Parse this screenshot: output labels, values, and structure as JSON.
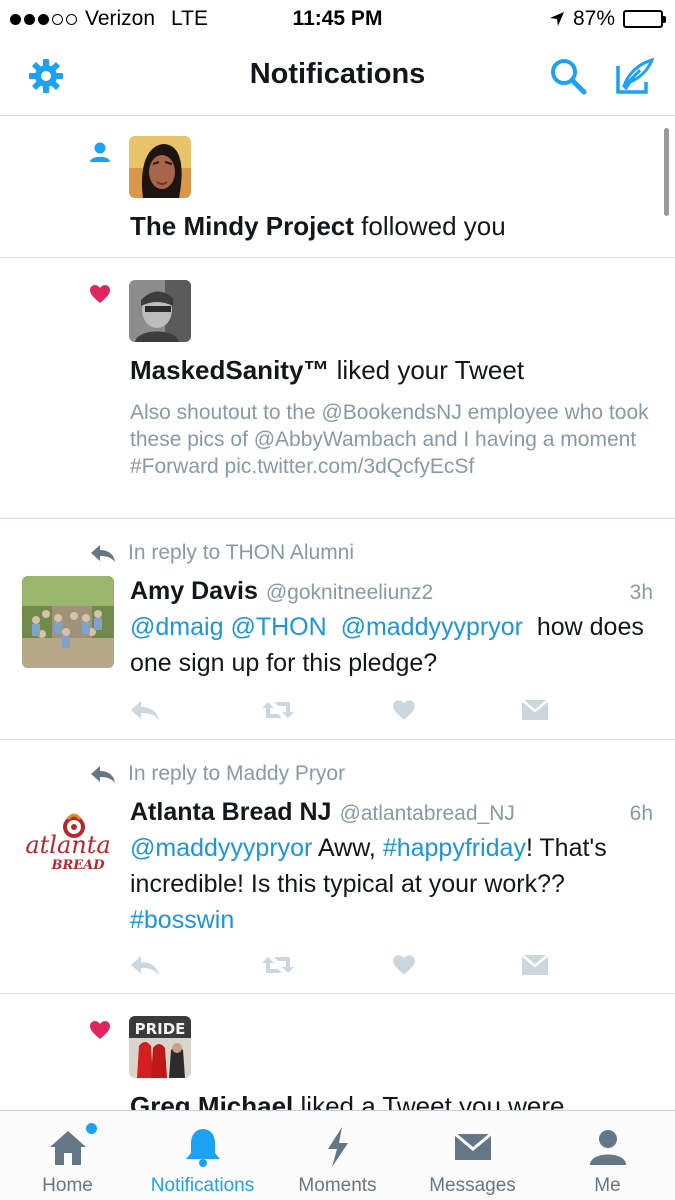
{
  "status_bar": {
    "carrier": "Verizon",
    "network": "LTE",
    "time": "11:45 PM",
    "battery": "87%",
    "battery_level": 0.87,
    "signal_bars": 3
  },
  "nav": {
    "title": "Notifications",
    "settings_icon": "gear-icon",
    "search_icon": "search-icon",
    "compose_icon": "compose-icon"
  },
  "notifications": [
    {
      "type": "follow",
      "icon": "person-icon",
      "actor": "The Mindy Project",
      "action": "followed you"
    },
    {
      "type": "like",
      "icon": "heart-icon",
      "actor": "MaskedSanity™",
      "action": "liked your Tweet",
      "quote": "Also shoutout to the @BookendsNJ employee who took these pics of @AbbyWambach and I having a moment #Forward pic.twitter.com/3dQcfyEcSf"
    },
    {
      "type": "reply",
      "reply_to": "In reply to THON Alumni",
      "name": "Amy Davis",
      "handle": "@goknitneeliunz2",
      "time": "3h",
      "mention1": "@dmaig",
      "mention2": "@THON",
      "mention3": "@maddyyypryor",
      "text_rest": "how does one sign up for this pledge?"
    },
    {
      "type": "reply",
      "reply_to": "In reply to Maddy Pryor",
      "name": "Atlanta Bread NJ",
      "handle": "@atlantabread_NJ",
      "time": "6h",
      "mention1": "@maddyyypryor",
      "text_mid": "Aww,",
      "hashtag1": "#happyfriday",
      "text_rest": "! That's incredible! Is this typical at your work??",
      "hashtag2": "#bosswin",
      "logo_text_1": "atlanta",
      "logo_text_2": "BREAD"
    },
    {
      "type": "like",
      "icon": "heart-icon",
      "actor": "Greg Michael",
      "action": "liked a Tweet you were",
      "avatar_text": "PRIDE"
    }
  ],
  "tabs": [
    {
      "label": "Home",
      "icon": "home-icon",
      "badge": true
    },
    {
      "label": "Notifications",
      "icon": "bell-icon",
      "active": true
    },
    {
      "label": "Moments",
      "icon": "lightning-icon"
    },
    {
      "label": "Messages",
      "icon": "envelope-icon"
    },
    {
      "label": "Me",
      "icon": "person-icon"
    }
  ],
  "colors": {
    "accent": "#1da1f2",
    "link": "#1b95e0",
    "like": "#e0245e",
    "secondary_text": "#8899a6",
    "icon_gray": "#ccd6dd"
  }
}
